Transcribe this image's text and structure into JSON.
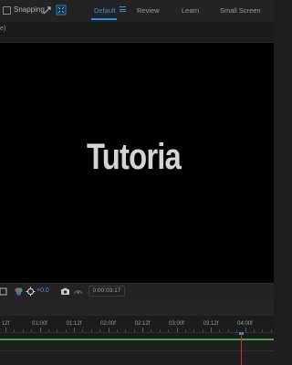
{
  "toolbar": {
    "snapping_label": "Snapping",
    "icons": [
      "snap-edges-icon",
      "snap-grid-icon"
    ],
    "workspaces": [
      {
        "label": "Default",
        "active": true
      },
      {
        "label": "Review",
        "active": false
      },
      {
        "label": "Learn",
        "active": false
      },
      {
        "label": "Small Screen",
        "active": false
      }
    ],
    "accent": "#2d8ceb"
  },
  "panel_header": {
    "text": "e)"
  },
  "composition": {
    "text": "Tutoria",
    "text_color": "#d4d4d4",
    "background": "#000000"
  },
  "viewer_bar": {
    "exposure": "+0.0",
    "timecode": "0:00:03:17",
    "icons": [
      "region-icon",
      "color-channels-icon",
      "exposure-icon",
      "snapshot-icon",
      "show-snapshot-icon"
    ]
  },
  "timeline": {
    "ruler_labels": [
      "12f",
      "01:00f",
      "01:12f",
      "02:00f",
      "02:12f",
      "03:00f",
      "03:12f",
      "04:00f"
    ],
    "track_color": "#47a63e",
    "playhead_color": "#d32a2a"
  }
}
